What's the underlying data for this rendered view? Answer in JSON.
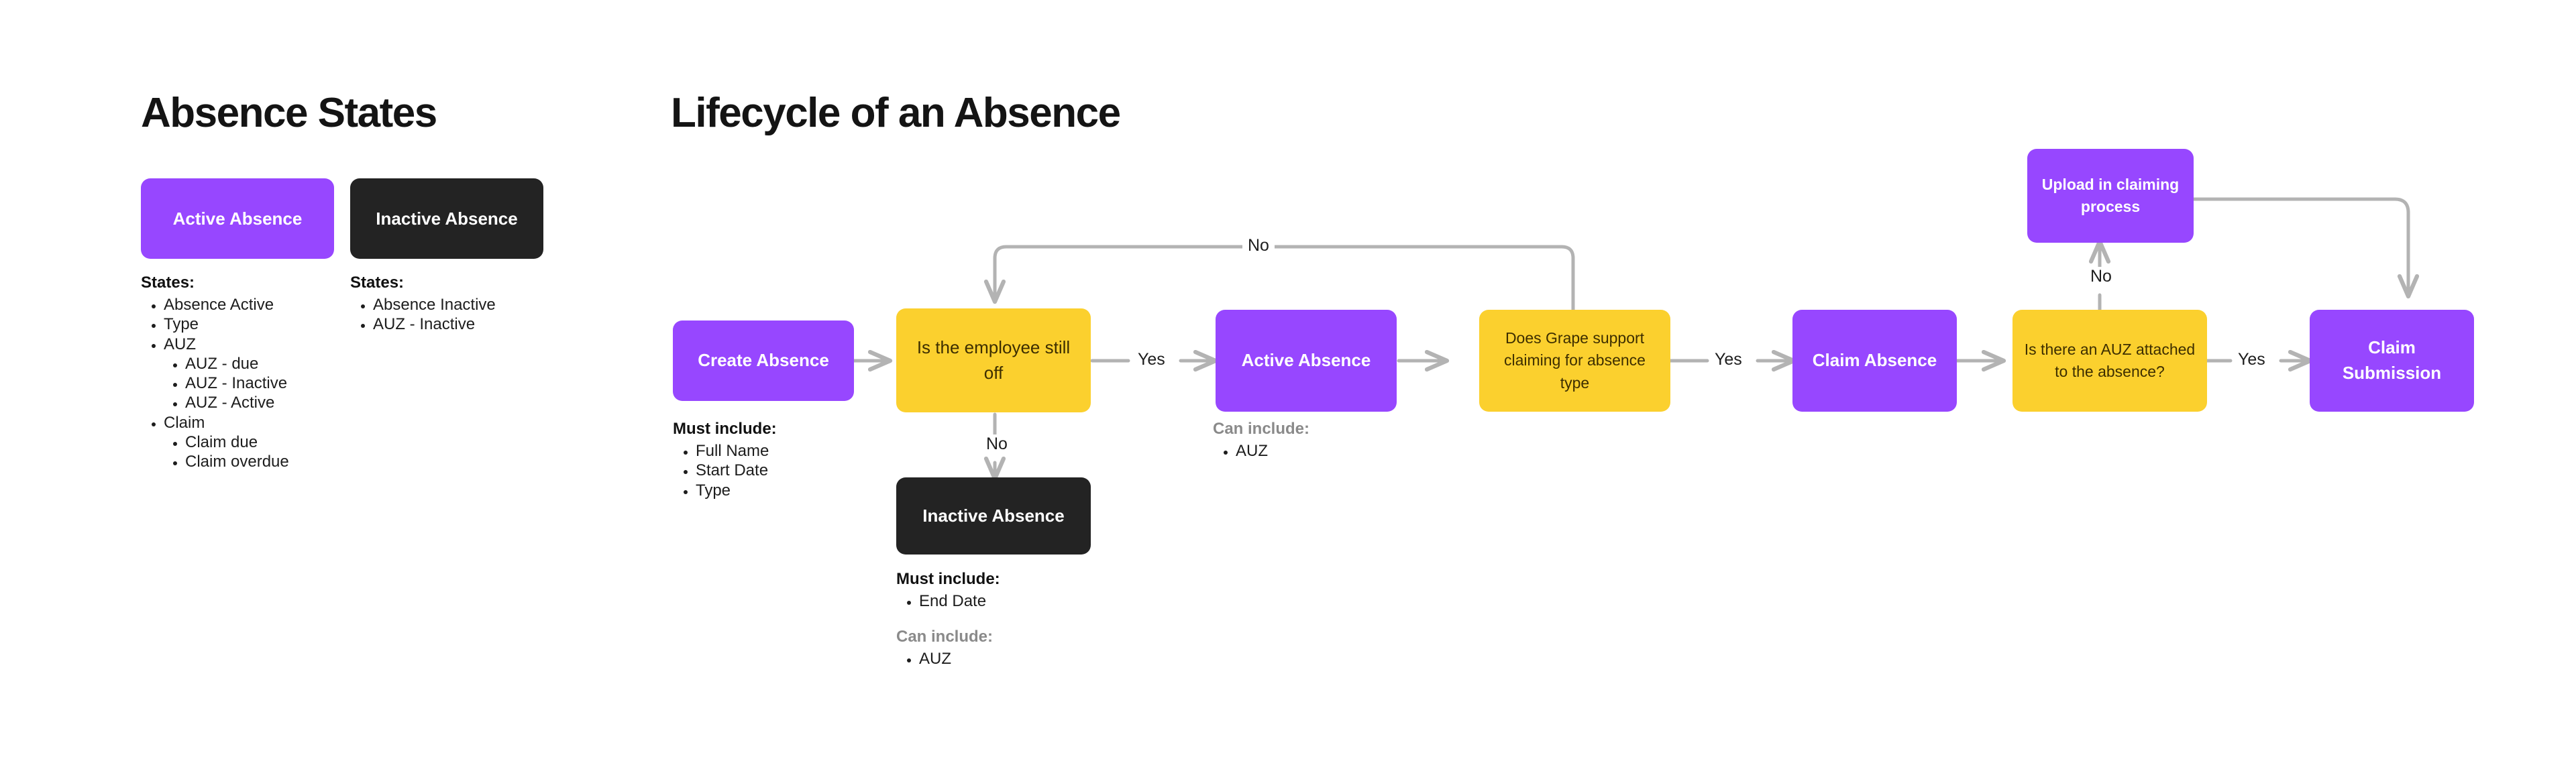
{
  "left_panel": {
    "title": "Absence States",
    "cards": [
      {
        "label": "Active Absence",
        "color": "#9747ff"
      },
      {
        "label": "Inactive Absence",
        "color": "#232323"
      }
    ],
    "active_states": {
      "heading": "States:",
      "items": [
        {
          "label": "Absence Active",
          "children": []
        },
        {
          "label": "Type",
          "children": []
        },
        {
          "label": "AUZ",
          "children": [
            "AUZ - due",
            "AUZ - Inactive",
            "AUZ - Active"
          ]
        },
        {
          "label": "Claim",
          "children": [
            "Claim due",
            "Claim overdue"
          ]
        }
      ]
    },
    "inactive_states": {
      "heading": "States:",
      "items": [
        {
          "label": "Absence Inactive",
          "children": []
        },
        {
          "label": "AUZ - Inactive",
          "children": []
        }
      ]
    }
  },
  "flow_panel": {
    "title": "Lifecycle of an Absence",
    "nodes": {
      "create_absence": "Create Absence",
      "is_employee_still_off": "Is the employee still off",
      "inactive_absence": "Inactive Absence",
      "active_absence": "Active Absence",
      "does_grape_support": "Does Grape support claiming for absence type",
      "claim_absence": "Claim Absence",
      "is_there_auz": "Is there an AUZ attached to the absence?",
      "claim_submission": "Claim Submission",
      "upload_in_claiming_process": "Upload in claiming process"
    },
    "edge_labels": {
      "no_loop_top": "No",
      "yes_after_question": "Yes",
      "no_to_inactive": "No",
      "yes_after_grape": "Yes",
      "yes_after_auz": "Yes",
      "no_to_upload": "No"
    },
    "annotations": {
      "create_absence_must": {
        "heading": "Must include:",
        "items": [
          "Full Name",
          "Start Date",
          "Type"
        ]
      },
      "active_absence_can": {
        "heading": "Can include:",
        "items": [
          "AUZ"
        ]
      },
      "inactive_absence_must": {
        "heading": "Must include:",
        "items": [
          "End Date"
        ]
      },
      "inactive_absence_can": {
        "heading": "Can include:",
        "items": [
          "AUZ"
        ]
      }
    }
  },
  "colors": {
    "purple": "#9747ff",
    "yellow": "#fbd02e",
    "dark": "#232323",
    "edge": "#b3b3b3",
    "muted_text": "#8a8a8a"
  }
}
